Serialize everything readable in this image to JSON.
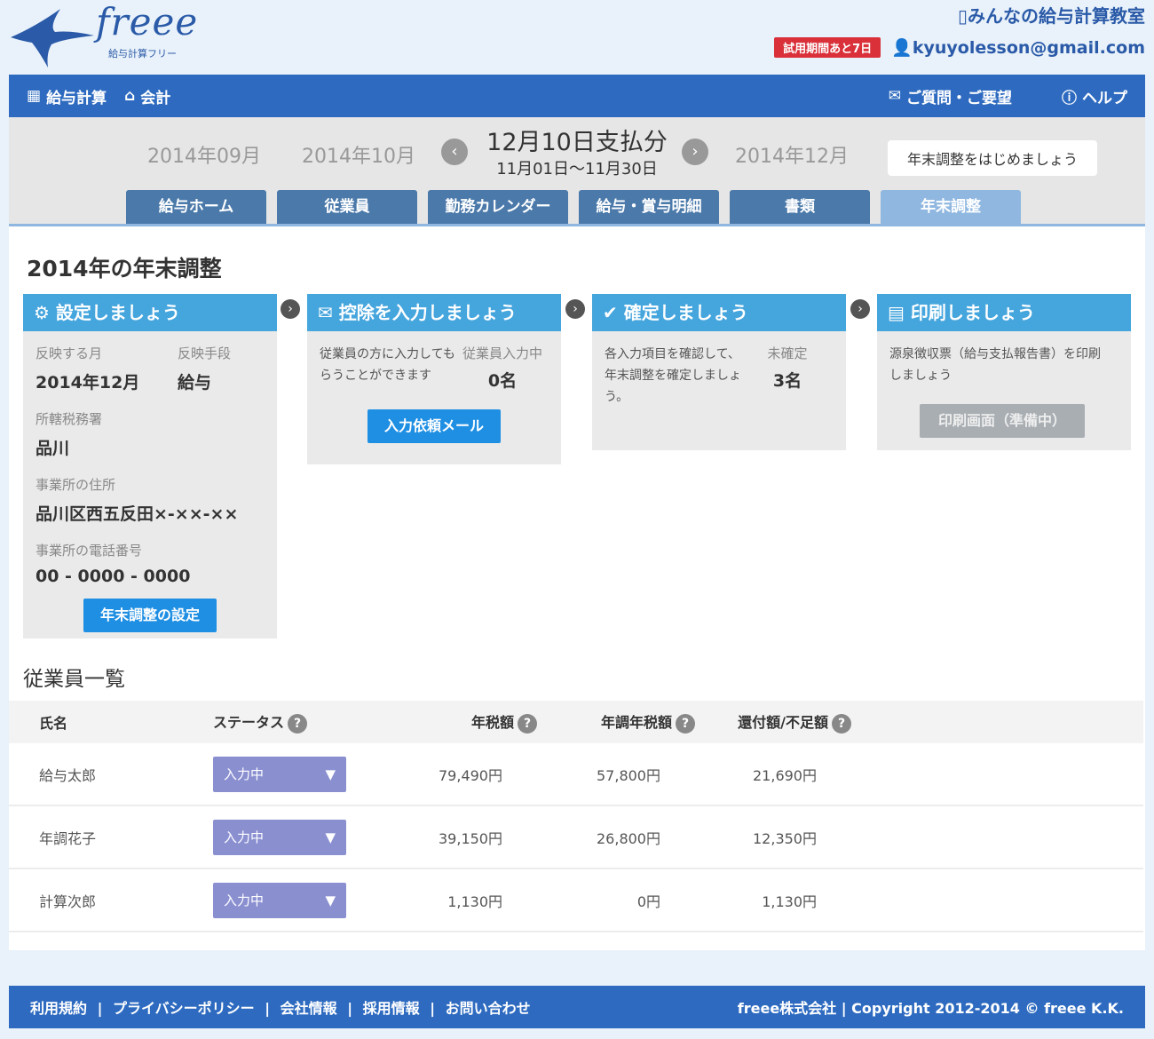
{
  "logo": {
    "text": "freee",
    "sub": "給与計算フリー"
  },
  "header": {
    "school_link": "みんなの給与計算教室",
    "trial_badge": "試用期間あと7日",
    "user_email": "kyuyolesson@gmail.com"
  },
  "nav": {
    "payroll": "給与計算",
    "accounting": "会計",
    "feedback": "ご質問・ご要望",
    "help": "ヘルプ"
  },
  "period": {
    "prev2": "2014年09月",
    "prev1": "2014年10月",
    "current_title": "12月10日支払分",
    "current_range": "11月01日〜11月30日",
    "next": "2014年12月",
    "badge": "年末調整をはじめましょう"
  },
  "tabs": [
    "給与ホーム",
    "従業員",
    "勤務カレンダー",
    "給与・賞与明細",
    "書類",
    "年末調整"
  ],
  "page": {
    "title": "2014年の年末調整"
  },
  "card1": {
    "head": "設定しましょう",
    "lbl_month": "反映する月",
    "val_month": "2014年12月",
    "lbl_method": "反映手段",
    "val_method": "給与",
    "lbl_office": "所轄税務署",
    "val_office": "品川",
    "lbl_addr": "事業所の住所",
    "val_addr": "品川区西五反田×-××-××",
    "lbl_tel": "事業所の電話番号",
    "val_tel": "00 - 0000 - 0000",
    "button": "年末調整の設定"
  },
  "card2": {
    "head": "控除を入力しましょう",
    "desc": "従業員の方に入力してもらうことができます",
    "lbl": "従業員入力中",
    "val": "0名",
    "button": "入力依頼メール"
  },
  "card3": {
    "head": "確定しましょう",
    "desc": "各入力項目を確認して、年末調整を確定しましょう。",
    "lbl": "未確定",
    "val": "3名"
  },
  "card4": {
    "head": "印刷しましょう",
    "desc": "源泉徴収票（給与支払報告書）を印刷しましょう",
    "button": "印刷画面（準備中）"
  },
  "employees": {
    "title": "従業員一覧",
    "headers": [
      "氏名",
      "ステータス",
      "年税額",
      "年調年税額",
      "還付額/不足額"
    ],
    "rows": [
      {
        "name": "給与太郎",
        "status": "入力中",
        "tax": "79,490円",
        "adj": "57,800円",
        "diff": "21,690円"
      },
      {
        "name": "年調花子",
        "status": "入力中",
        "tax": "39,150円",
        "adj": "26,800円",
        "diff": "12,350円"
      },
      {
        "name": "計算次郎",
        "status": "入力中",
        "tax": "1,130円",
        "adj": "0円",
        "diff": "1,130円"
      }
    ]
  },
  "footer": {
    "links": [
      "利用規約",
      "プライバシーポリシー",
      "会社情報",
      "採用情報",
      "お問い合わせ"
    ],
    "company": "freee株式会社",
    "copyright": "Copyright 2012-2014 © freee K.K."
  }
}
